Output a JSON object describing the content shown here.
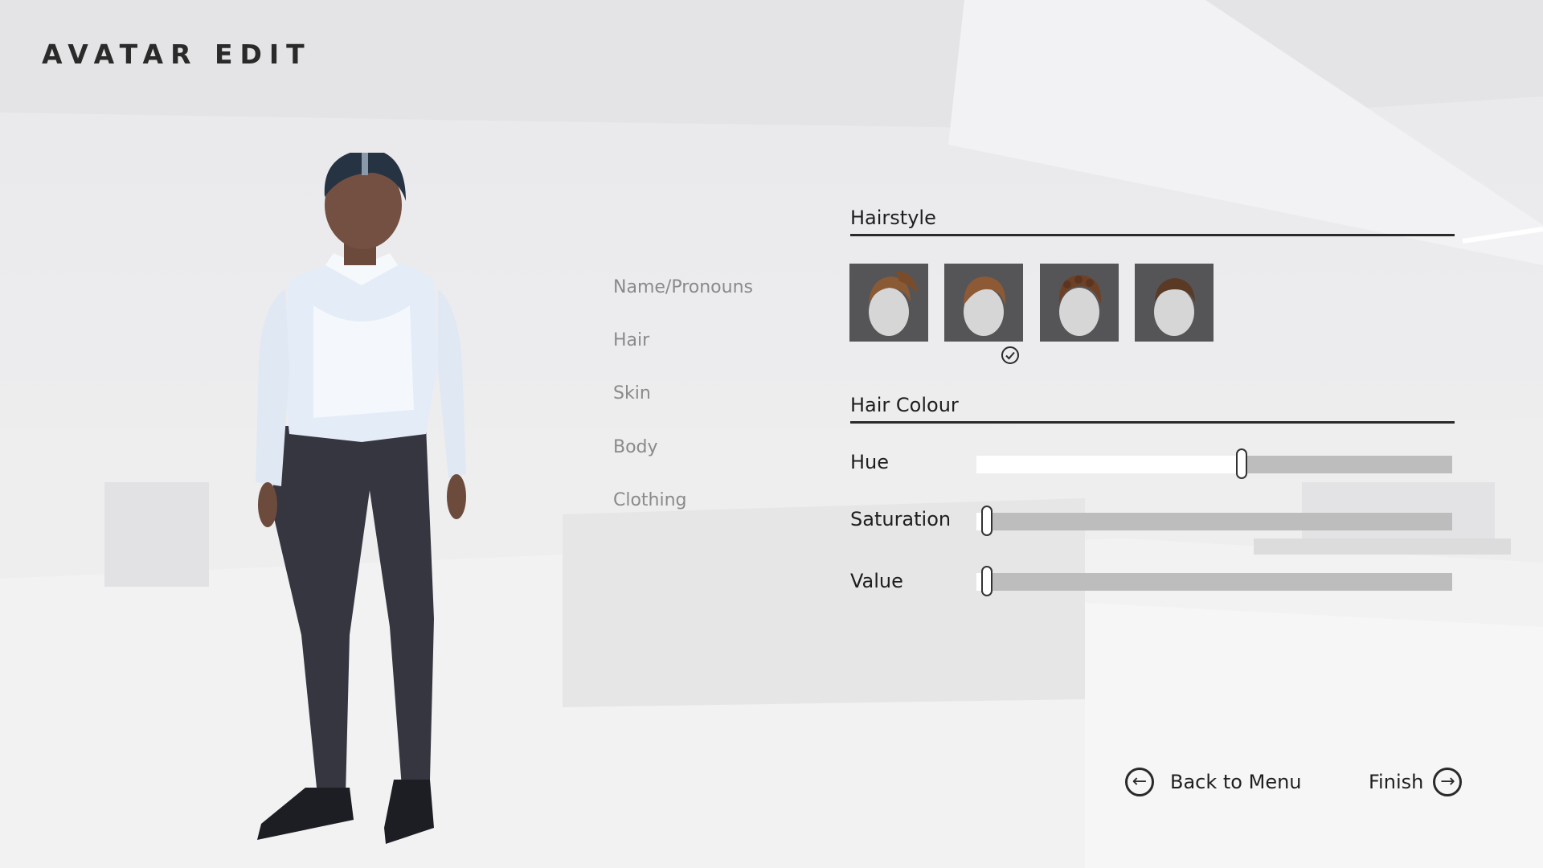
{
  "title": "AVATAR EDIT",
  "menu": {
    "items": [
      {
        "label": "Name/Pronouns"
      },
      {
        "label": "Hair"
      },
      {
        "label": "Skin"
      },
      {
        "label": "Body"
      },
      {
        "label": "Clothing"
      }
    ]
  },
  "hairstyle": {
    "heading": "Hairstyle",
    "options": [
      {
        "icon": "ponytail-hair-icon",
        "selected": false
      },
      {
        "icon": "side-part-hair-icon",
        "selected": true
      },
      {
        "icon": "curly-hair-icon",
        "selected": false
      },
      {
        "icon": "short-crop-hair-icon",
        "selected": false
      }
    ],
    "selected_icon": "checkmark-circle-icon"
  },
  "hair_colour": {
    "heading": "Hair Colour",
    "sliders": [
      {
        "label": "Hue",
        "value": 0.56
      },
      {
        "label": "Saturation",
        "value": 0.0
      },
      {
        "label": "Value",
        "value": 0.0
      }
    ]
  },
  "footer": {
    "back_label": "Back to Menu",
    "back_icon": "arrow-left-circle-icon",
    "finish_label": "Finish",
    "finish_icon": "arrow-right-circle-icon"
  },
  "colors": {
    "text": "#1e1e1e",
    "menu_text": "#8a8a8a",
    "swatch_bg": "#555557",
    "track": "#bdbdbd",
    "track_fill": "#ffffff"
  }
}
